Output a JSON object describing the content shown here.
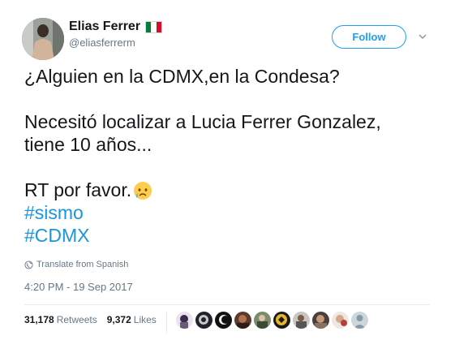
{
  "author": {
    "name": "Elias Ferrer",
    "handle": "@eliasferrerm",
    "flag_icon": "mexico-flag-icon"
  },
  "follow_button_label": "Follow",
  "tweet": {
    "line1": "¿Alguien en la CDMX,en la Condesa?",
    "line2": "Necesitó localizar a Lucia Ferrer Gonzalez,",
    "line3": "tiene 10 años...",
    "line4": "RT por favor.",
    "emoji": "crying-face-emoji",
    "hashtags": [
      "#sismo",
      "#CDMX"
    ]
  },
  "translate_label": "Translate from Spanish",
  "timestamp": "4:20 PM - 19 Sep 2017",
  "stats": {
    "retweets_count": "31,178",
    "retweets_label": "Retweets",
    "likes_count": "9,372",
    "likes_label": "Likes"
  },
  "likers": [
    "avatar-1",
    "avatar-2",
    "avatar-3",
    "avatar-4",
    "avatar-5",
    "avatar-6",
    "avatar-7",
    "avatar-8",
    "avatar-9",
    "avatar-10"
  ],
  "colors": {
    "accent": "#1da1f2",
    "hashtag": "#1b95e0",
    "secondary_text": "#657786",
    "primary_text": "#14171a"
  }
}
